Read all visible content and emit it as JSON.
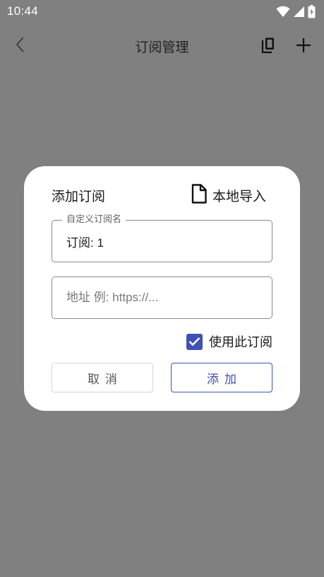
{
  "status_bar": {
    "time": "10:44",
    "icons": [
      "wifi-icon",
      "cellular-signal-icon",
      "battery-charging-icon"
    ]
  },
  "app_bar": {
    "title": "订阅管理",
    "back_icon": "chevron-left-icon",
    "actions": [
      "copy-icon",
      "plus-icon"
    ]
  },
  "dialog": {
    "title": "添加订阅",
    "import_label": "本地导入",
    "import_icon": "file-icon",
    "name_field": {
      "label": "自定义订阅名",
      "value": "订阅: 1"
    },
    "url_field": {
      "value": "",
      "placeholder": "地址 例: https://..."
    },
    "use_checkbox": {
      "label": "使用此订阅",
      "checked": true
    },
    "cancel_label": "取消",
    "add_label": "添加"
  },
  "colors": {
    "scrim": "#808080",
    "accent": "#3f51b5",
    "surface": "#ffffff"
  }
}
